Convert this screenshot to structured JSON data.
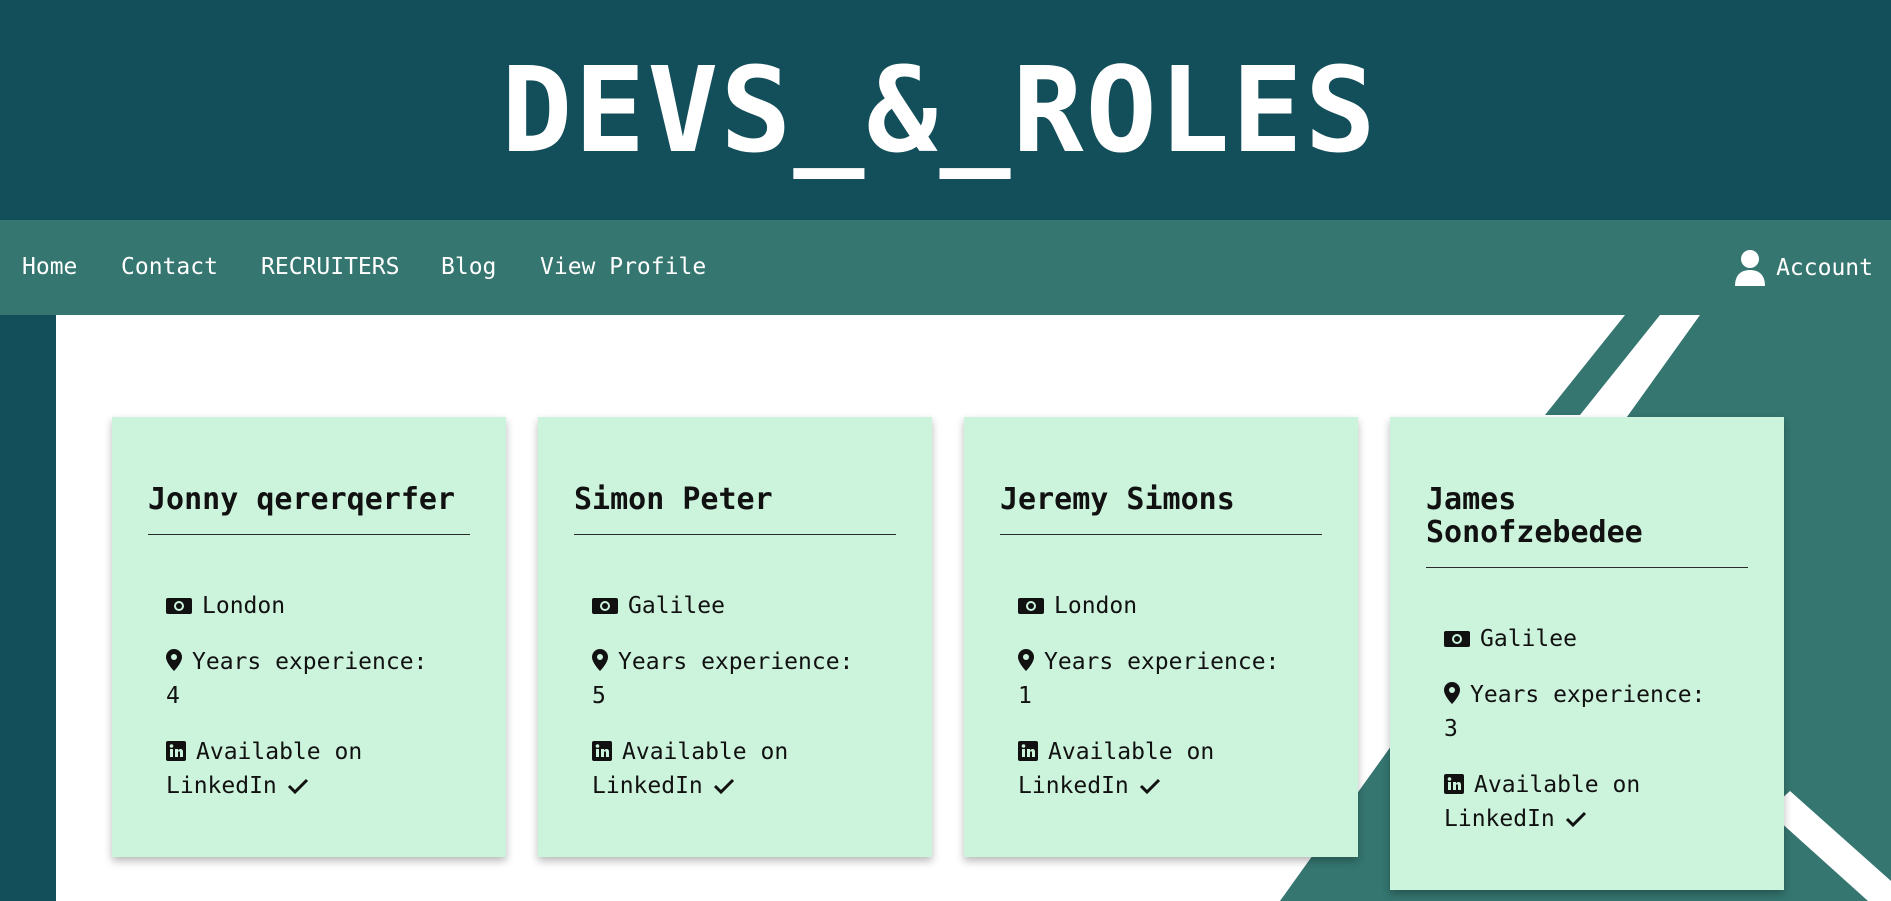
{
  "header": {
    "title": "DEVS_&_ROLES"
  },
  "nav": {
    "items": [
      {
        "label": "Home"
      },
      {
        "label": "Contact"
      },
      {
        "label": "RECRUITERS"
      },
      {
        "label": "Blog"
      },
      {
        "label": "View Profile"
      }
    ],
    "account_label": "Account"
  },
  "icons": {
    "account": "user-icon",
    "location": "money-bill-icon",
    "experience": "map-marker-icon",
    "linkedin": "linkedin-icon",
    "available": "check-icon"
  },
  "colors": {
    "header_bg": "#134f5a",
    "nav_bg": "#357670",
    "card_bg": "#ccf3dc",
    "panel_bg": "#ffffff"
  },
  "profiles": [
    {
      "name": "Jonny qererqerfer",
      "location": "London",
      "experience_label": "Years experience:",
      "experience_years": "4",
      "linkedin_label": "Available on LinkedIn"
    },
    {
      "name": "Simon Peter",
      "location": "Galilee",
      "experience_label": "Years experience:",
      "experience_years": "5",
      "linkedin_label": "Available on LinkedIn"
    },
    {
      "name": "Jeremy Simons",
      "location": "London",
      "experience_label": "Years experience:",
      "experience_years": "1",
      "linkedin_label": "Available on LinkedIn"
    },
    {
      "name": "James Sonofzebedee",
      "location": "Galilee",
      "experience_label": "Years experience:",
      "experience_years": "3",
      "linkedin_label": "Available on LinkedIn"
    }
  ]
}
